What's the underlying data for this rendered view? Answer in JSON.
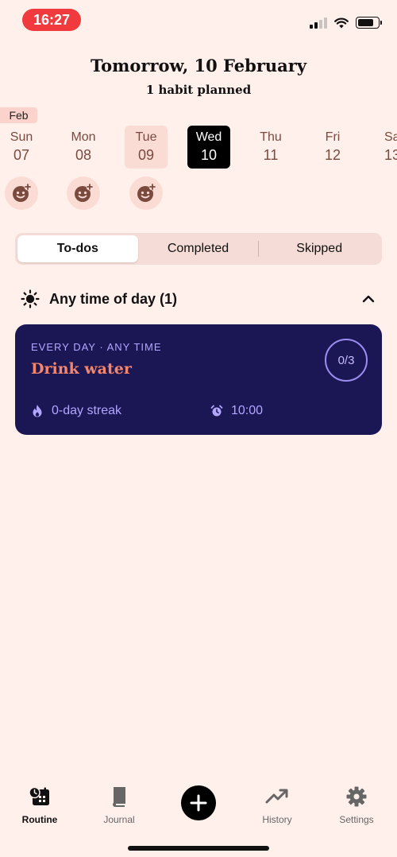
{
  "status": {
    "time": "16:27"
  },
  "header": {
    "title": "Tomorrow, 10 February",
    "subtitle": "1 habit planned"
  },
  "calendar": {
    "month": "Feb",
    "days": [
      {
        "name": "Sun",
        "date": "07",
        "state": "past",
        "has_mood_button": true
      },
      {
        "name": "Mon",
        "date": "08",
        "state": "past",
        "has_mood_button": true
      },
      {
        "name": "Tue",
        "date": "09",
        "state": "today",
        "has_mood_button": true
      },
      {
        "name": "Wed",
        "date": "10",
        "state": "selected",
        "has_mood_button": false
      },
      {
        "name": "Thu",
        "date": "11",
        "state": "future",
        "has_mood_button": false
      },
      {
        "name": "Fri",
        "date": "12",
        "state": "future",
        "has_mood_button": false
      },
      {
        "name": "Sat",
        "date": "13",
        "state": "future",
        "has_mood_button": false
      }
    ]
  },
  "tabs": {
    "todos": "To-dos",
    "completed": "Completed",
    "skipped": "Skipped",
    "active": "todos"
  },
  "section": {
    "title": "Any time of day (1)",
    "icon": "sun-icon",
    "expanded": true
  },
  "habit": {
    "meta": "EVERY DAY · ANY TIME",
    "title": "Drink water",
    "progress": "0/3",
    "streak": "0-day streak",
    "reminder": "10:00"
  },
  "nav": {
    "routine": "Routine",
    "journal": "Journal",
    "history": "History",
    "settings": "Settings",
    "active": "routine"
  },
  "colors": {
    "background": "#fff0eb",
    "card": "#1b1755",
    "habit_title": "#f4866b",
    "card_text": "#b2a6ff",
    "status_pill": "#f03a3e"
  }
}
